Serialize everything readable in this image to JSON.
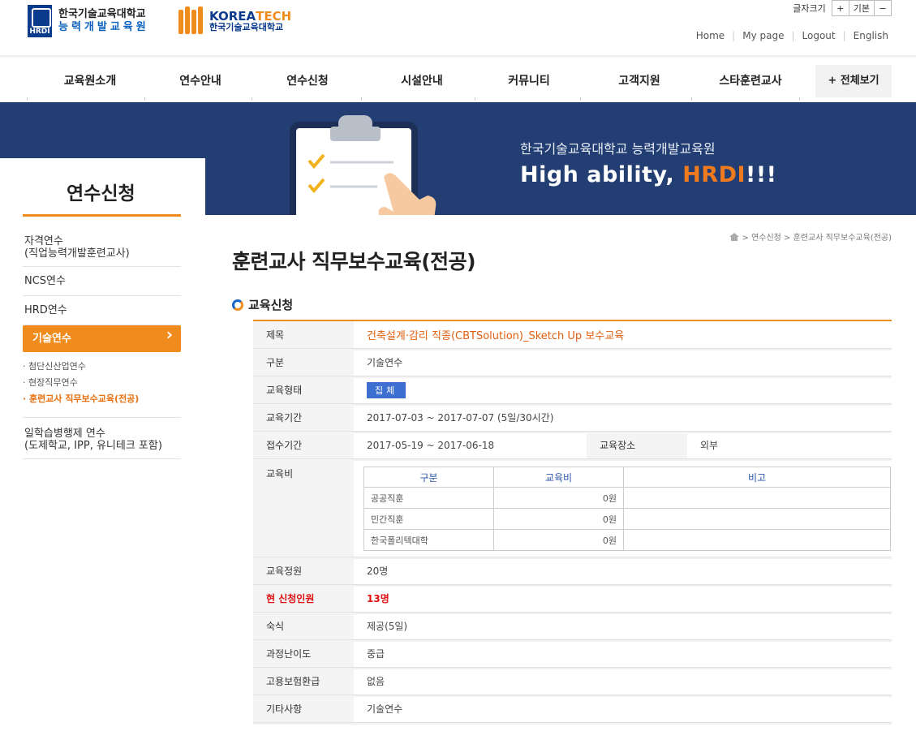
{
  "header": {
    "logo1_line1": "한국기술교육대학교",
    "logo1_line2": "능력개발교육원",
    "logo1_mark": "HRDI",
    "logo2_word_a": "KOREA",
    "logo2_word_b": "TECH",
    "logo2_line2": "한국기술교육대학교",
    "fontsize_label": "글자크기",
    "fontsize_plus": "+",
    "fontsize_default": "기본",
    "fontsize_minus": "−",
    "util": [
      "Home",
      "My page",
      "Logout",
      "English"
    ]
  },
  "gnb": {
    "items": [
      "교육원소개",
      "연수안내",
      "연수신청",
      "시설안내",
      "커뮤니티",
      "고객지원",
      "스타훈련교사"
    ],
    "all_label": "+ 전체보기"
  },
  "banner": {
    "subtitle": "한국기술교육대학교 능력개발교육원",
    "main_a": "High ability, ",
    "main_b": "HRDI",
    "main_c": "!!!"
  },
  "lnb": {
    "title": "연수신청",
    "items": [
      {
        "label": "자격연수\n(직업능력개발훈련교사)"
      },
      {
        "label": "NCS연수"
      },
      {
        "label": "HRD연수"
      },
      {
        "label": "기술연수"
      },
      {
        "label": "일학습병행제 연수\n(도제학교, IPP, 유니테크 포함)"
      }
    ],
    "subs": [
      "· 첨단신산업연수",
      "· 현장직무연수",
      "· 훈련교사 직무보수교육(전공)"
    ]
  },
  "location": "> 연수신청 > 훈련교사 직무보수교육(전공)",
  "page_title": "훈련교사 직무보수교육(전공)",
  "section_title": "교육신청",
  "info": {
    "title_label": "제목",
    "title_value": "건축설계·감리 직종(CBTSolution)_Sketch Up 보수교육",
    "type_label": "구분",
    "type_value": "기술연수",
    "form_label": "교육형태",
    "form_value": "집체",
    "period_label": "교육기간",
    "period_value": "2017-07-03 ~ 2017-07-07 (5일/30시간)",
    "apply_label": "접수기간",
    "apply_value": "2017-05-19 ~ 2017-06-18",
    "place_label": "교육장소",
    "place_value": "외부",
    "fee_label": "교육비",
    "fee_headers": [
      "구분",
      "교육비",
      "비고"
    ],
    "fee_rows": [
      [
        "공공직훈",
        "0원",
        ""
      ],
      [
        "민간직훈",
        "0원",
        ""
      ],
      [
        "한국폴리텍대학",
        "0원",
        ""
      ]
    ],
    "capacity_label": "교육정원",
    "capacity_value": "20명",
    "current_label": "현 신청인원",
    "current_value": "13명",
    "lodging_label": "숙식",
    "lodging_value": "제공(5일)",
    "level_label": "과정난이도",
    "level_value": "중급",
    "refund_label": "고용보험환급",
    "refund_value": "없음",
    "etc_label": "기타사항",
    "etc_value": "기술연수"
  },
  "colors": {
    "accent": "#f08c1e",
    "banner": "#223e73",
    "title_orange": "#e05f0e",
    "red": "#e01010",
    "badge_blue": "#3c6fcf"
  }
}
